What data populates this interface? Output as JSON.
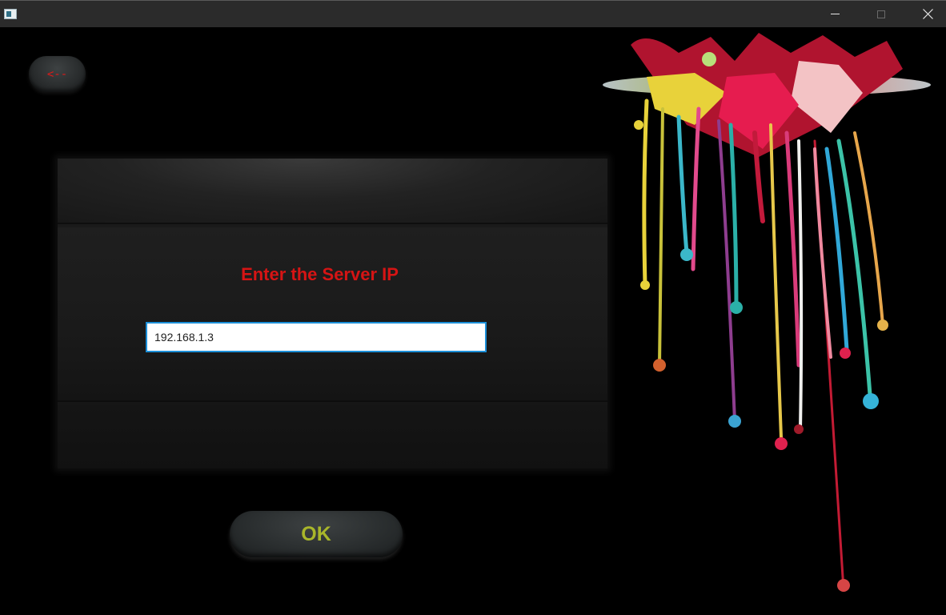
{
  "window": {
    "title": "",
    "controls": {
      "minimize": "minimize",
      "maximize": "maximize",
      "close": "close"
    }
  },
  "back_button": {
    "label": "<--",
    "color": "#e01818"
  },
  "form": {
    "prompt": "Enter the Server IP",
    "prompt_color": "#d61414",
    "ip_value": "192.168.1.3",
    "input_border_color": "#1c8fd8"
  },
  "ok_button": {
    "label": "OK",
    "color": "#a9b62a"
  },
  "icons": {
    "app": "app-window-icon",
    "minimize": "minimize-icon",
    "maximize": "maximize-icon",
    "close": "close-icon",
    "art": "paint-drip-artwork"
  }
}
